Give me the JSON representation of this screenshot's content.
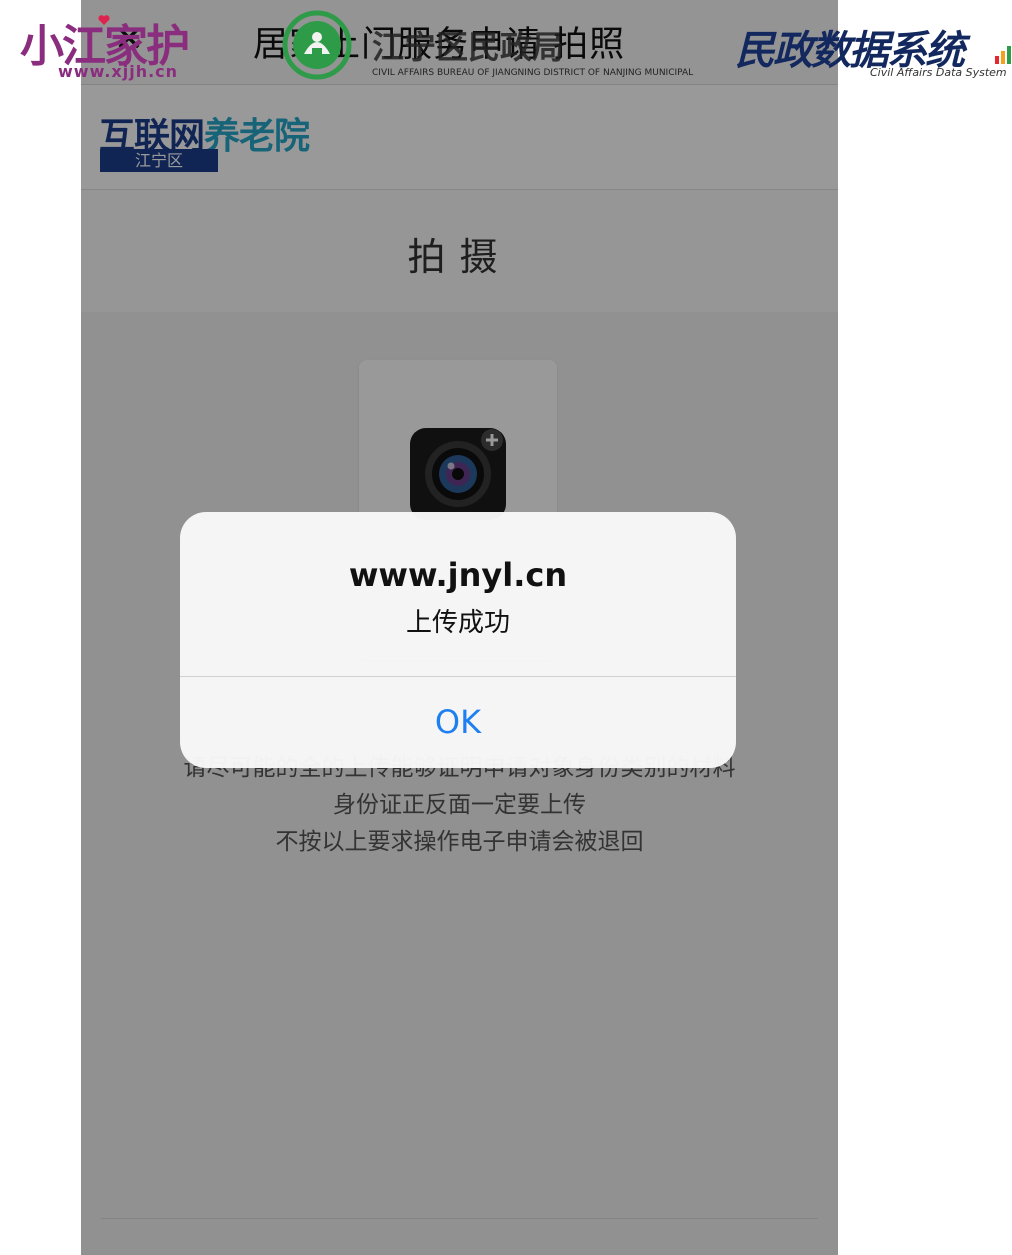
{
  "watermarks": {
    "left": {
      "text": "小江家护",
      "url": "www.xjjh.cn"
    },
    "center": {
      "title": "江宁区民政局",
      "subtitle": "CIVIL AFFAIRS BUREAU OF JIANGNING DISTRICT OF NANJING MUNICIPAL"
    },
    "right": {
      "title": "民政数据系统",
      "subtitle": "Civil Affairs Data System"
    }
  },
  "nav": {
    "close_icon": "close-icon",
    "title": "居家上门服务申请 拍照"
  },
  "brand": {
    "title_main": "互联网",
    "title_accent": "养老院",
    "subtitle": "江宁区"
  },
  "page": {
    "title": "拍摄",
    "camera_icon": "camera-add-icon"
  },
  "instructions": [
    "请尽可能的全的上传能够证明申请对象身份类别的材料",
    "身份证正反面一定要上传",
    "不按以上要求操作电子申请会被退回"
  ],
  "alert": {
    "title": "www.jnyl.cn",
    "message": "上传成功",
    "ok_label": "OK"
  },
  "colors": {
    "alert_button": "#1e7ff0",
    "brand_blue": "#1d3f8e",
    "brand_accent": "#27a6c9",
    "watermark_purple": "#8a2d7e",
    "overlay": "rgba(0,0,0,0.40)"
  }
}
